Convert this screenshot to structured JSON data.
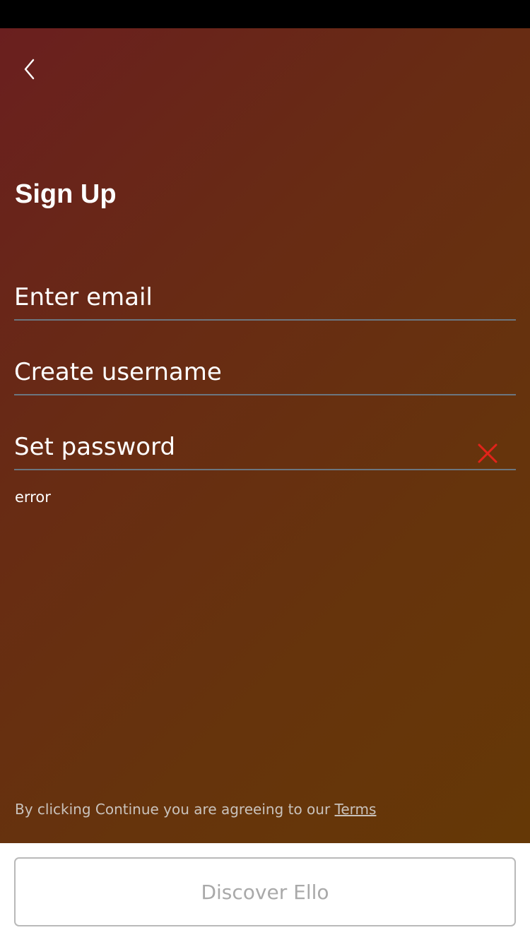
{
  "status_bar": {},
  "header": {
    "back_icon": "chevron-left-icon"
  },
  "main": {
    "title": "Sign Up",
    "fields": {
      "email": {
        "placeholder": "Enter email",
        "value": ""
      },
      "username": {
        "placeholder": "Create username",
        "value": ""
      },
      "password": {
        "placeholder": "Set password",
        "value": "",
        "status_icon": "error-x-icon"
      }
    },
    "error_message": "error"
  },
  "footer": {
    "terms_prefix": "By clicking Continue you are agreeing to our ",
    "terms_link": "Terms",
    "discover_button": "Discover Ello"
  },
  "colors": {
    "status_bar": "#000000",
    "gradient_start": "#6a1f1f",
    "gradient_end": "#653806",
    "error_accent": "#e2231a",
    "field_underline": "#6b7680",
    "button_border": "#b9b9b9",
    "button_text": "#a9a9a9"
  }
}
